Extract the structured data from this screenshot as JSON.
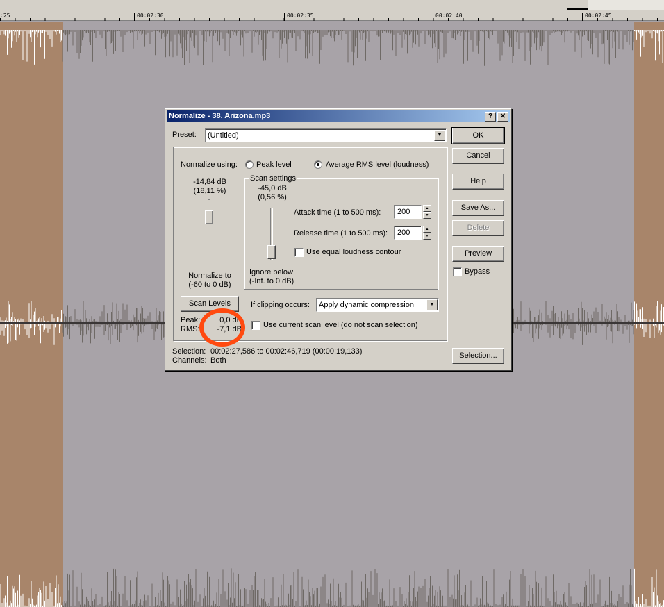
{
  "ruler": {
    "labels": [
      ":25",
      "00:02:30",
      "00:02:35",
      "00:02:40",
      "00:02:45"
    ]
  },
  "dialog": {
    "title": "Normalize - 38. Arizona.mp3",
    "help_btn": "?",
    "close_btn": "✕",
    "preset_label": "Preset:",
    "preset_value": "(Untitled)",
    "normalize_using_label": "Normalize using:",
    "peak_level_label": "Peak level",
    "avg_rms_label": "Average RMS level (loudness)",
    "mode_selected": "rms",
    "level_db": "-14,84 dB",
    "level_pct": "(18,11 %)",
    "normalize_to_label": "Normalize to",
    "normalize_to_range": "(-60 to 0 dB)",
    "scan_settings_label": "Scan settings",
    "ignore_db": "-45,0 dB",
    "ignore_pct": "(0,56 %)",
    "attack_label": "Attack time (1 to 500 ms):",
    "attack_value": "200",
    "release_label": "Release time (1 to 500 ms):",
    "release_value": "200",
    "equal_loudness_label": "Use equal loudness contour",
    "ignore_below_label": "Ignore below",
    "ignore_below_range": "(-Inf. to 0 dB)",
    "scan_levels_btn": "Scan Levels",
    "peak_label": "Peak:",
    "peak_value": "0,0 dB",
    "rms_label": "RMS:",
    "rms_value": "-7,1 dB",
    "clipping_label": "If clipping occurs:",
    "clipping_value": "Apply dynamic compression",
    "use_current_scan_label": "Use current scan level (do not scan selection)",
    "selection_label": "Selection:",
    "selection_value": "00:02:27,586 to 00:02:46,719 (00:00:19,133)",
    "channels_label": "Channels:",
    "channels_value": "Both",
    "ok_btn": "OK",
    "cancel_btn": "Cancel",
    "help_button": "Help",
    "save_as_btn": "Save As...",
    "delete_btn": "Delete",
    "preview_btn": "Preview",
    "bypass_label": "Bypass",
    "selection_btn": "Selection..."
  },
  "colors": {
    "waveform_selected": "#a8a3a8",
    "waveform_unselected": "#a8856a",
    "annotation": "#ff4a10"
  }
}
